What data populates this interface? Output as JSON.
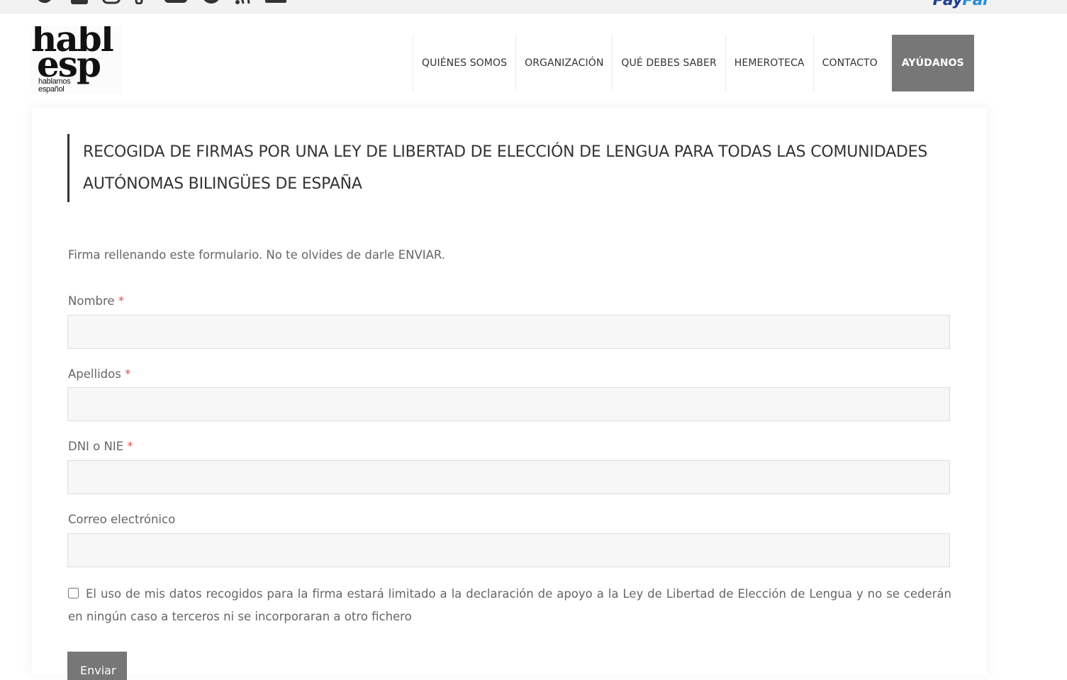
{
  "social_icons": [
    "twitter-icon",
    "facebook-icon",
    "instagram-icon",
    "tiktok-icon",
    "youtube-icon",
    "telegram-icon",
    "rss-icon",
    "email-icon"
  ],
  "paypal": {
    "pay": "Pay",
    "pal": "Pal"
  },
  "logo": {
    "line1": "habl",
    "line2": "esp",
    "small1": "hablamos",
    "small2": "español"
  },
  "nav": {
    "items": [
      "QUIÉNES SOMOS",
      "ORGANIZACIÓN",
      "QUÉ DEBES SABER",
      "HEMEROTECA",
      "CONTACTO"
    ],
    "cta": "AYÚDANOS"
  },
  "content": {
    "title": "RECOGIDA DE FIRMAS POR UNA LEY DE LIBERTAD DE ELECCIÓN DE LENGUA PARA TODAS LAS COMUNIDADES AUTÓNOMAS BILINGÜES DE ESPAÑA",
    "intro": "Firma rellenando este formulario. No te olvides de darle ENVIAR."
  },
  "form": {
    "required_marker": "*",
    "fields": [
      {
        "label": "Nombre",
        "value": ""
      },
      {
        "label": "Apellidos",
        "value": ""
      },
      {
        "label": "DNI o NIE",
        "value": ""
      },
      {
        "label": "Correo electrónico",
        "value": ""
      }
    ],
    "consent_text": "El uso de mis datos recogidos para la firma estará limitado a la declaración de apoyo a la Ley de Libertad de Elección de Lengua y no se cederán en ningún caso a terceros ni se incorporaran a otro fichero",
    "consent_checked": false,
    "submit_label": "Enviar"
  },
  "colors": {
    "accent": "#777777",
    "required": "#d9534f",
    "text": "#666666"
  }
}
